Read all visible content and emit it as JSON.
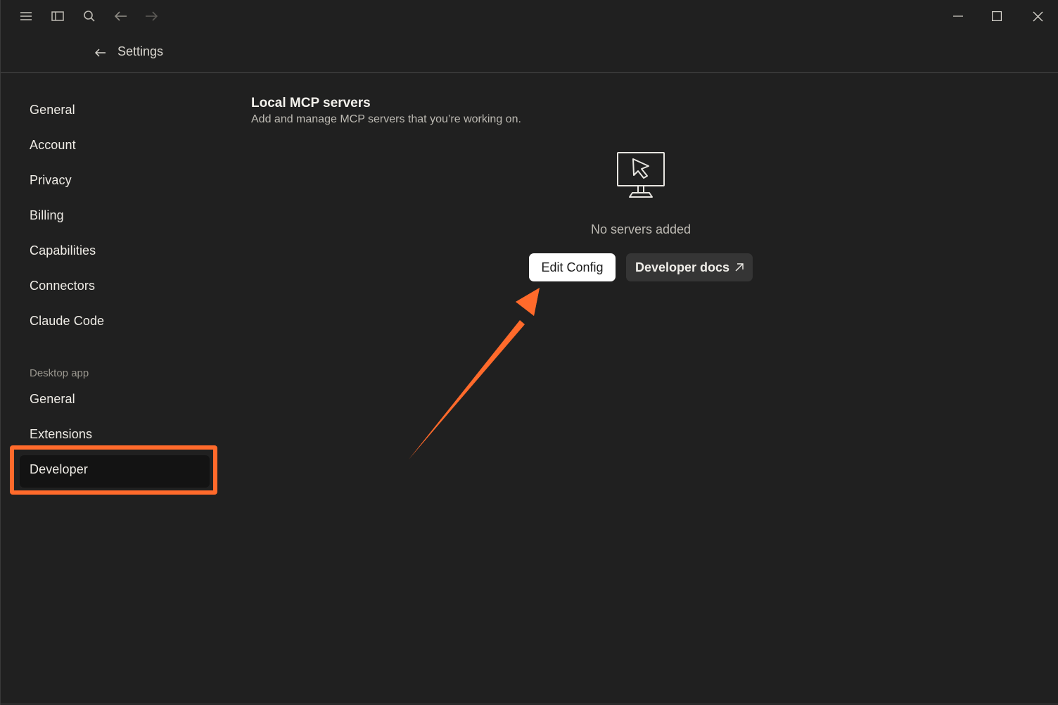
{
  "titlebar": {
    "icons": [
      "menu-icon",
      "sidebar-toggle-icon",
      "search-icon",
      "back-arrow-icon",
      "forward-arrow-icon"
    ],
    "window_controls": [
      "minimize-icon",
      "maximize-icon",
      "close-icon"
    ]
  },
  "header": {
    "title": "Settings"
  },
  "sidebar": {
    "items": [
      {
        "label": "General"
      },
      {
        "label": "Account"
      },
      {
        "label": "Privacy"
      },
      {
        "label": "Billing"
      },
      {
        "label": "Capabilities"
      },
      {
        "label": "Connectors"
      },
      {
        "label": "Claude Code"
      }
    ],
    "section_label": "Desktop app",
    "desktop_items": [
      {
        "label": "General"
      },
      {
        "label": "Extensions"
      },
      {
        "label": "Developer",
        "active": true
      }
    ]
  },
  "main": {
    "title": "Local MCP servers",
    "subtitle": "Add and manage MCP servers that you’re working on.",
    "empty_icon": "monitor-cursor-icon",
    "empty_text": "No servers added",
    "edit_config_label": "Edit Config",
    "developer_docs_label": "Developer docs",
    "developer_docs_icon": "external-link-arrow-icon"
  },
  "annotation": {
    "color": "#ff6a2b"
  },
  "colors": {
    "background": "#202020",
    "accent": "#ff6a2b",
    "primary_button": "#ffffff",
    "secondary_button": "#353535"
  }
}
